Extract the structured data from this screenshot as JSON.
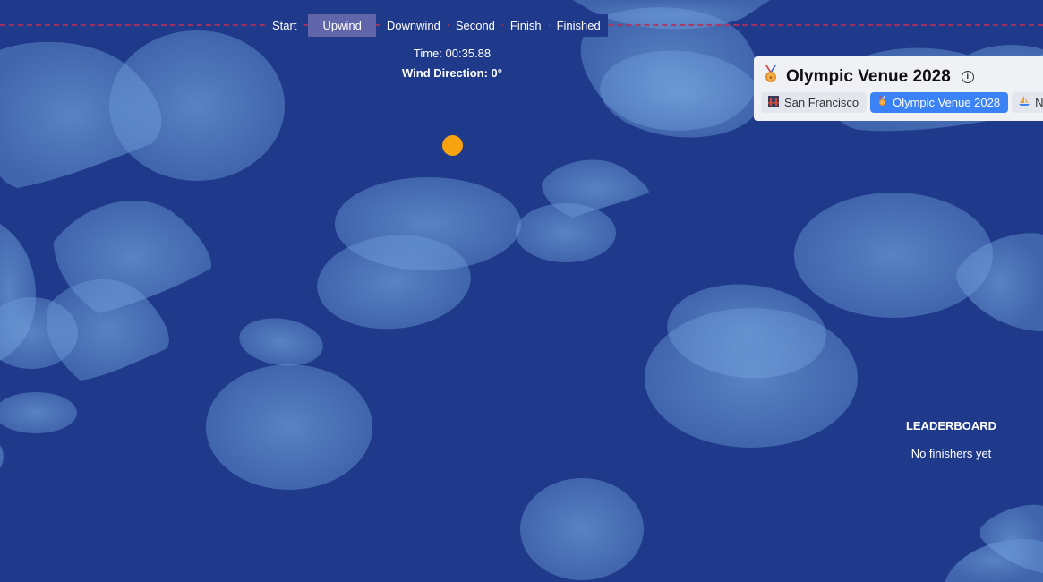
{
  "race": {
    "stages": [
      {
        "label": "Start",
        "active": false
      },
      {
        "label": "Upwind",
        "active": true
      },
      {
        "label": "Downwind",
        "active": false
      },
      {
        "label": "Second",
        "active": false
      },
      {
        "label": "Finish",
        "active": false
      },
      {
        "label": "Finished",
        "active": false
      }
    ],
    "time_text": "Time: 00:35.88",
    "wind_text": "Wind Direction: 0°"
  },
  "venue": {
    "title": "Olympic Venue 2028",
    "title_icon": "medal-icon",
    "info_icon": "info-icon",
    "tabs": [
      {
        "label": "San Francisco",
        "icon": "bridge-icon",
        "selected": false
      },
      {
        "label": "Olympic Venue 2028",
        "icon": "medal-icon",
        "selected": true
      },
      {
        "label": "N",
        "icon": "sailboat-icon",
        "selected": false
      }
    ]
  },
  "leaderboard": {
    "title": "LEADERBOARD",
    "empty_text": "No finishers yet"
  },
  "colors": {
    "water": "#1f3a8a",
    "wind_patch": "#7aaae6",
    "boat": "#f6a30f",
    "progress_line": "#b4305a",
    "active_stage": "#6166aa",
    "selected_tab": "#3b82f6"
  }
}
